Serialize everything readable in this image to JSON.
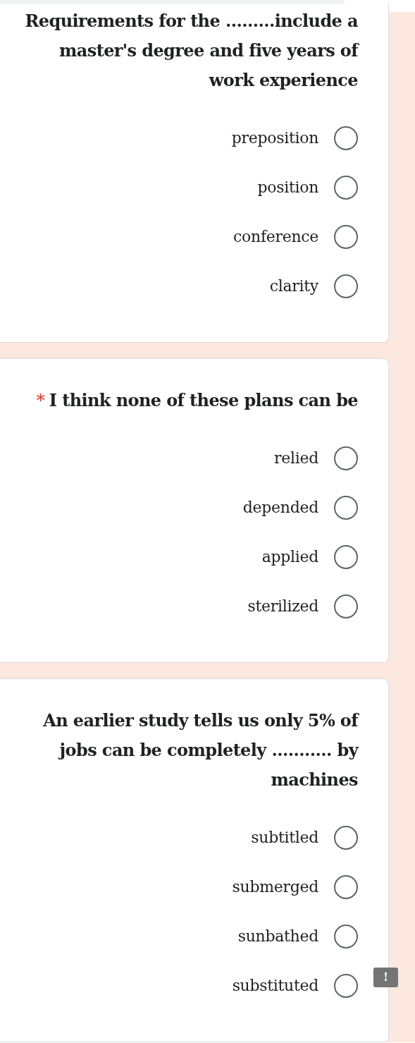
{
  "questions": [
    {
      "text": "Requirements for the .........include a master's degree and five years of work experience",
      "options": [
        {
          "label": "preposition",
          "selected": false
        },
        {
          "label": "position",
          "selected": false
        },
        {
          "label": "conference",
          "selected": false
        },
        {
          "label": "clarity",
          "selected": false
        }
      ]
    },
    {
      "text": "I think none of these plans can be",
      "required_mark": "*",
      "options": [
        {
          "label": "relied",
          "selected": false
        },
        {
          "label": "depended",
          "selected": false
        },
        {
          "label": "applied",
          "selected": false
        },
        {
          "label": "sterilized",
          "selected": false
        }
      ]
    },
    {
      "text": "An earlier study tells us only 5% of jobs can be completely ........... by machines",
      "options": [
        {
          "label": "subtitled",
          "selected": false
        },
        {
          "label": "submerged",
          "selected": false
        },
        {
          "label": "sunbathed",
          "selected": false
        },
        {
          "label": "substituted",
          "selected": false
        }
      ]
    }
  ],
  "feedback": {
    "label": "!"
  }
}
